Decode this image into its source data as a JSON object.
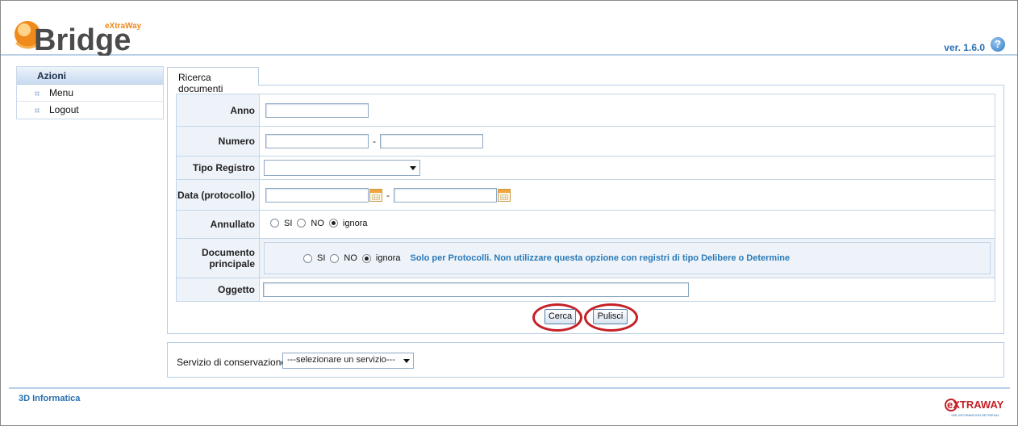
{
  "header": {
    "logo_small": "eXtraWay",
    "logo_main": "Bridge",
    "version": "ver. 1.6.0",
    "help": "?"
  },
  "sidebar": {
    "title": "Azioni",
    "items": [
      {
        "label": "Menu"
      },
      {
        "label": "Logout"
      }
    ]
  },
  "tab": {
    "label": "Ricerca documenti"
  },
  "form": {
    "anno": {
      "label": "Anno",
      "value": ""
    },
    "numero": {
      "label": "Numero",
      "from": "",
      "to": "",
      "separator": "-"
    },
    "tipo_registro": {
      "label": "Tipo Registro",
      "selected": ""
    },
    "data": {
      "label": "Data (protocollo)",
      "from": "",
      "to": "",
      "separator": "-"
    },
    "annullato": {
      "label": "Annullato",
      "options": [
        "SI",
        "NO",
        "ignora"
      ],
      "selected": "ignora"
    },
    "documento_principale": {
      "label_line1": "Documento",
      "label_line2": "principale",
      "options": [
        "SI",
        "NO",
        "ignora"
      ],
      "selected": "ignora",
      "note": "Solo per Protocolli. Non utilizzare questa opzione con registri di tipo Delibere o Determine"
    },
    "oggetto": {
      "label": "Oggetto",
      "value": ""
    }
  },
  "buttons": {
    "search": "Cerca",
    "clear": "Pulisci"
  },
  "service": {
    "label": "Servizio di conservazione:",
    "selected": "---selezionare un servizio---"
  },
  "footer": {
    "brand": "3D Informatica",
    "logo": "eXTRAWAY",
    "logo_tagline": "XML INFORMATION RETRIEVAL"
  },
  "colors": {
    "accent": "#2a6fb0",
    "highlight_ring": "#c42026",
    "logo_orange": "#f08a1c"
  }
}
